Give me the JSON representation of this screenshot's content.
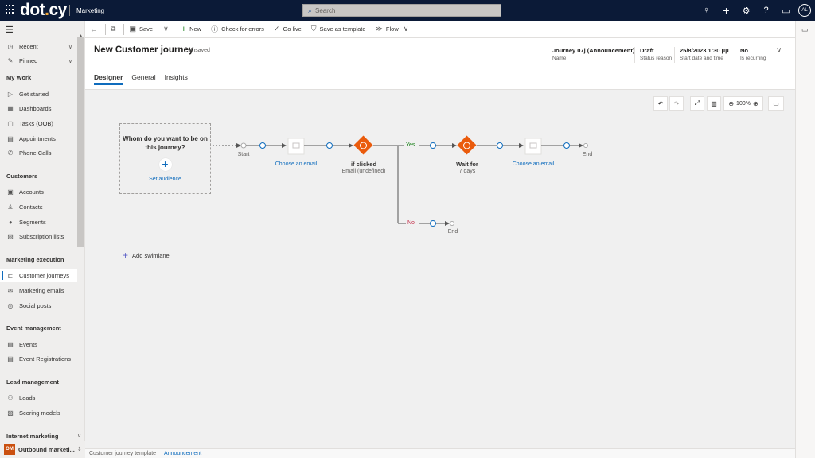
{
  "topbar": {
    "brand_main": "dot",
    "brand_dot": ".",
    "brand_tail": "cy",
    "app_name": "Marketing",
    "search_placeholder": "Search",
    "icons": [
      "lightbulb-icon",
      "plus-icon",
      "gear-icon",
      "help-icon",
      "chat-icon"
    ],
    "avatar_initials": "AL"
  },
  "sidebar": {
    "top_items": [
      {
        "label": "Recent",
        "icon": "clock-icon"
      },
      {
        "label": "Pinned",
        "icon": "pin-icon"
      }
    ],
    "groups": [
      {
        "heading": "My Work",
        "items": [
          {
            "label": "Get started",
            "icon": "play-icon"
          },
          {
            "label": "Dashboards",
            "icon": "dashboard-icon"
          },
          {
            "label": "Tasks (OOB)",
            "icon": "task-icon"
          },
          {
            "label": "Appointments",
            "icon": "calendar-icon"
          },
          {
            "label": "Phone Calls",
            "icon": "phone-icon"
          }
        ]
      },
      {
        "heading": "Customers",
        "items": [
          {
            "label": "Accounts",
            "icon": "building-icon"
          },
          {
            "label": "Contacts",
            "icon": "person-icon"
          },
          {
            "label": "Segments",
            "icon": "pie-icon"
          },
          {
            "label": "Subscription lists",
            "icon": "list-icon"
          }
        ]
      },
      {
        "heading": "Marketing execution",
        "items": [
          {
            "label": "Customer journeys",
            "icon": "journey-icon",
            "active": true
          },
          {
            "label": "Marketing emails",
            "icon": "mail-icon"
          },
          {
            "label": "Social posts",
            "icon": "social-icon"
          }
        ]
      },
      {
        "heading": "Event management",
        "items": [
          {
            "label": "Events",
            "icon": "calendar-icon"
          },
          {
            "label": "Event Registrations",
            "icon": "calendar-icon"
          }
        ]
      },
      {
        "heading": "Lead management",
        "items": [
          {
            "label": "Leads",
            "icon": "leads-icon"
          },
          {
            "label": "Scoring models",
            "icon": "scoring-icon"
          }
        ]
      },
      {
        "heading": "Internet marketing",
        "items": []
      }
    ],
    "area": {
      "badge": "OM",
      "label": "Outbound marketi..."
    }
  },
  "commandbar": {
    "save": "Save",
    "new": "New",
    "check_errors": "Check for errors",
    "go_live": "Go live",
    "save_template": "Save as template",
    "flow": "Flow"
  },
  "header": {
    "title": "New Customer journey",
    "unsaved": "- Unsaved",
    "fields": [
      {
        "value": "Journey 07j (Announcement)",
        "label": "Name"
      },
      {
        "value": "Draft",
        "label": "Status reason"
      },
      {
        "value": "25/8/2023 1:30 μμ",
        "label": "Start date and time"
      },
      {
        "value": "No",
        "label": "Is recurring"
      }
    ],
    "tabs": [
      "Designer",
      "General",
      "Insights"
    ]
  },
  "canvas": {
    "zoom": "100%",
    "audience_question": "Whom do you want to be on this journey?",
    "set_audience": "Set audience",
    "start": "Start",
    "choose_email_1": "Choose an email",
    "condition_title": "if clicked",
    "condition_sub": "Email (undefined)",
    "yes": "Yes",
    "no": "No",
    "wait_title": "Wait for",
    "wait_sub": "7 days",
    "choose_email_2": "Choose an email",
    "end": "End",
    "add_swimlane": "Add swimlane",
    "accent_orange": "#ea5b0c",
    "link_blue": "#0f6cbd"
  },
  "footer": {
    "label": "Customer journey template",
    "value": "Announcement"
  }
}
